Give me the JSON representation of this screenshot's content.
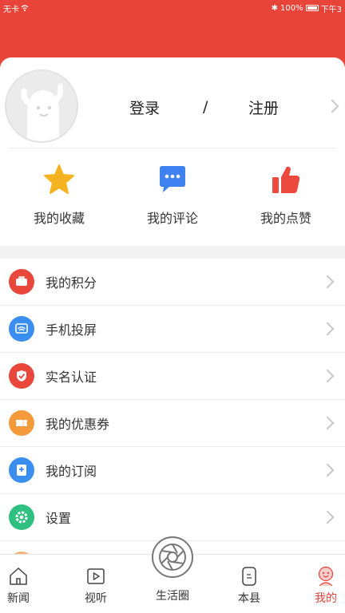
{
  "status": {
    "carrier": "无卡",
    "battery": "100%",
    "time": "下午3"
  },
  "profile": {
    "login": "登录",
    "separator": "/",
    "register": "注册"
  },
  "quick_actions": [
    {
      "label": "我的收藏",
      "icon": "star-icon",
      "color": "#f6b321"
    },
    {
      "label": "我的评论",
      "icon": "comment-icon",
      "color": "#3d82f0"
    },
    {
      "label": "我的点赞",
      "icon": "thumbs-up-icon",
      "color": "#ec4a3f"
    }
  ],
  "menu": [
    {
      "label": "我的积分",
      "icon": "points-icon",
      "color": "#e9463c"
    },
    {
      "label": "手机投屏",
      "icon": "cast-screen-icon",
      "color": "#3a8ef0"
    },
    {
      "label": "实名认证",
      "icon": "verify-icon",
      "color": "#e9463c"
    },
    {
      "label": "我的优惠券",
      "icon": "coupon-icon",
      "color": "#f59a3a"
    },
    {
      "label": "我的订阅",
      "icon": "subscribe-icon",
      "color": "#3a8ef0"
    },
    {
      "label": "设置",
      "icon": "settings-icon",
      "color": "#2fc07f"
    }
  ],
  "tabs": [
    {
      "label": "新闻",
      "icon": "home-icon"
    },
    {
      "label": "视听",
      "icon": "video-play-icon"
    },
    {
      "label": "生活圈",
      "icon": "aperture-icon"
    },
    {
      "label": "本县",
      "icon": "county-icon"
    },
    {
      "label": "我的",
      "icon": "profile-icon",
      "active": true
    }
  ],
  "colors": {
    "brand": "#e8443a"
  }
}
